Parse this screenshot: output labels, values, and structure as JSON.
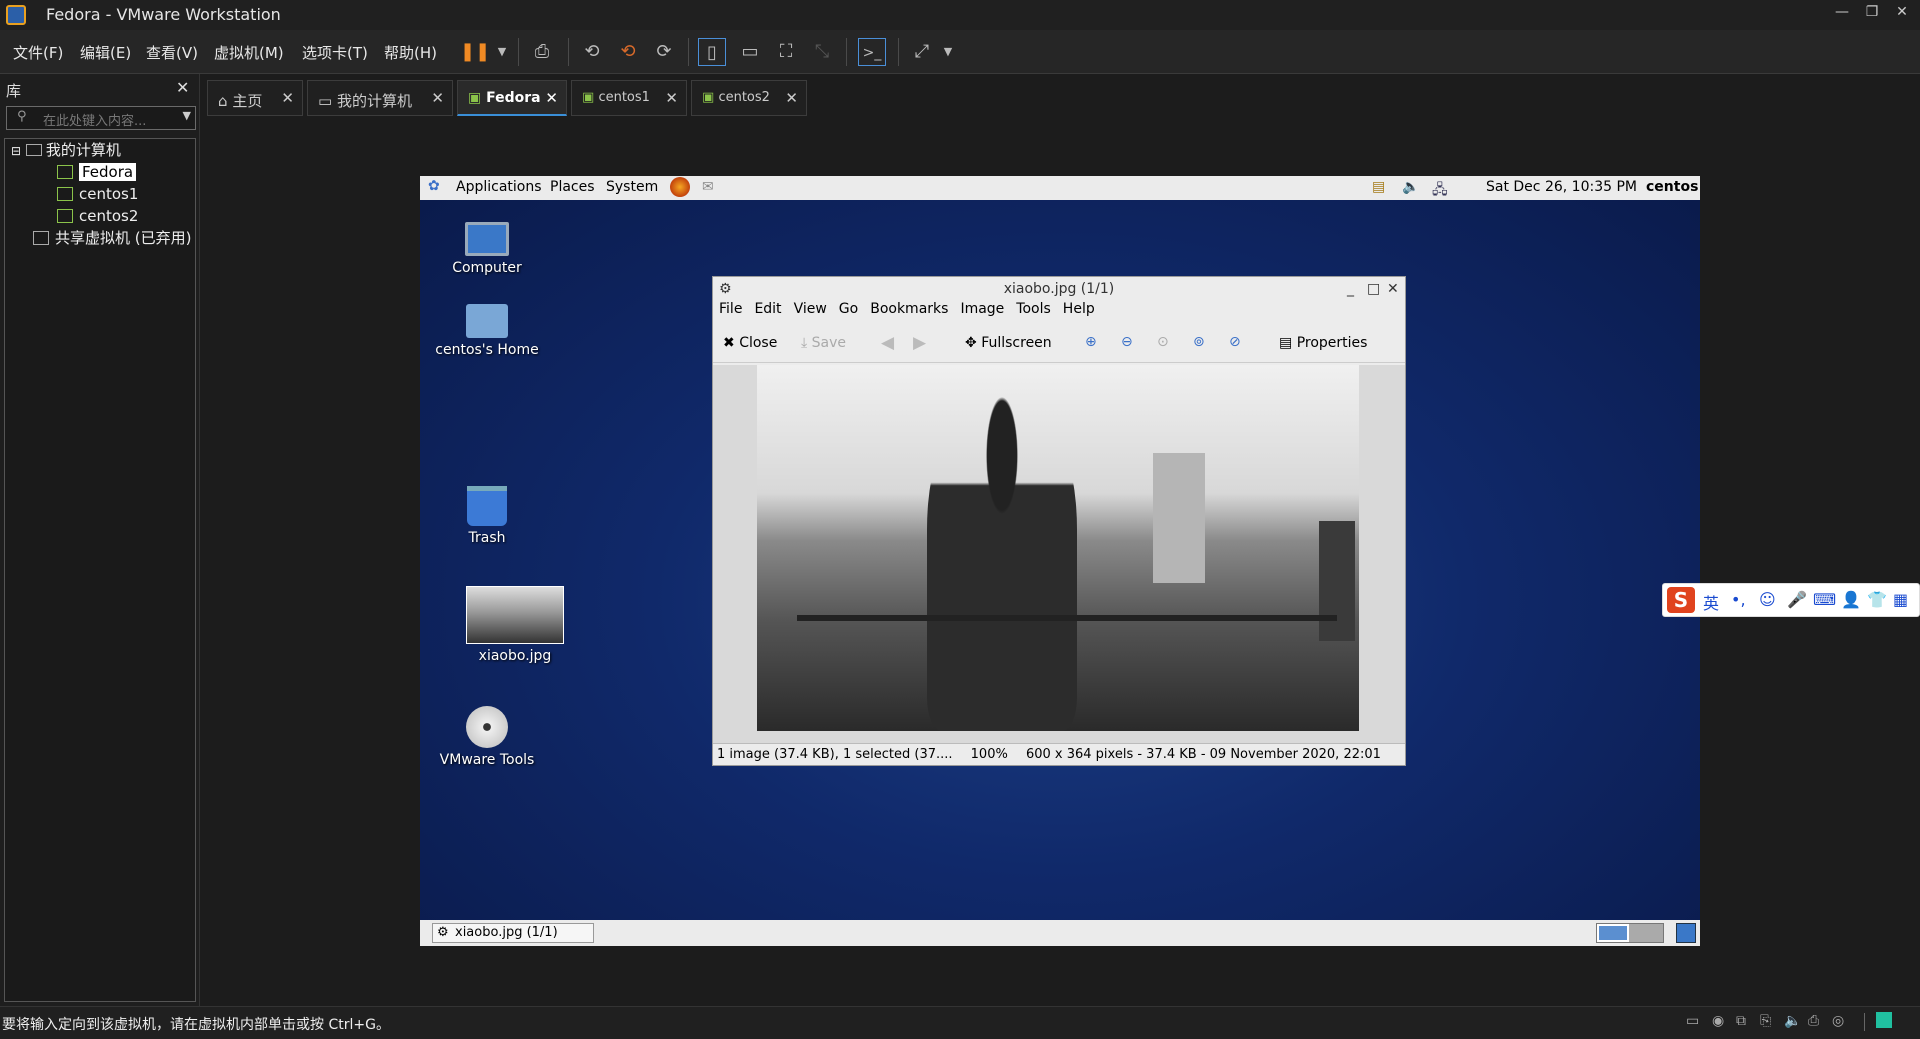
{
  "window": {
    "title": "Fedora - VMware Workstation"
  },
  "menu": [
    "文件(F)",
    "编辑(E)",
    "查看(V)",
    "虚拟机(M)",
    "选项卡(T)",
    "帮助(H)"
  ],
  "library": {
    "header": "库",
    "search_placeholder": "在此处键入内容...",
    "root": "我的计算机",
    "items": [
      "Fedora",
      "centos1",
      "centos2"
    ],
    "shared": "共享虚拟机 (已弃用)"
  },
  "tabs": [
    "主页",
    "我的计算机",
    "Fedora",
    "centos1",
    "centos2"
  ],
  "guest": {
    "panel": {
      "applications": "Applications",
      "places": "Places",
      "system": "System",
      "clock": "Sat Dec 26, 10:35 PM",
      "user": "centos"
    },
    "desktop_icons": [
      "Computer",
      "centos's Home",
      "Trash",
      "xiaobo.jpg",
      "VMware Tools"
    ],
    "taskbar_item": "xiaobo.jpg  (1/1)"
  },
  "viewer": {
    "title": "xiaobo.jpg  (1/1)",
    "menu": [
      "File",
      "Edit",
      "View",
      "Go",
      "Bookmarks",
      "Image",
      "Tools",
      "Help"
    ],
    "toolbar": {
      "close": "Close",
      "save": "Save",
      "fullscreen": "Fullscreen",
      "properties": "Properties"
    },
    "status": {
      "count": "1 image (37.4 KB), 1 selected (37....",
      "zoom": "100%",
      "info": "600 x 364 pixels - 37.4 KB - 09 November 2020, 22:01"
    }
  },
  "ime": {
    "label": "英"
  },
  "statusbar": {
    "message": "要将输入定向到该虚拟机，请在虚拟机内部单击或按 Ctrl+G。"
  }
}
